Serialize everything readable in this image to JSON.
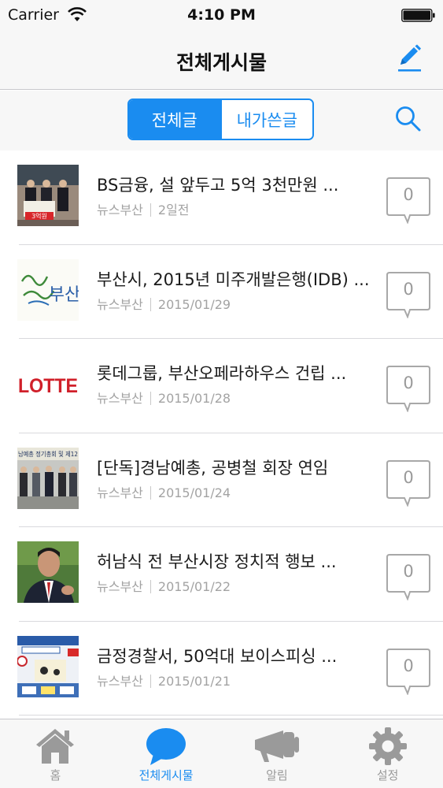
{
  "status_bar": {
    "carrier": "Carrier",
    "time": "4:10 PM"
  },
  "nav": {
    "title": "전체게시물",
    "compose_icon": "pencil-icon"
  },
  "segments": {
    "all": "전체글",
    "mine": "내가쓴글"
  },
  "search_icon": "search-icon",
  "posts": [
    {
      "title": "BS금융, 설 앞두고 5억 3천만원 ...",
      "source": "뉴스부산",
      "date": "2일전",
      "comments": "0",
      "thumb_text": "3억원"
    },
    {
      "title": "부산시, 2015년 미주개발은행(IDB) ...",
      "source": "뉴스부산",
      "date": "2015/01/29",
      "comments": "0",
      "thumb_text": "부산"
    },
    {
      "title": "롯데그룹, 부산오페라하우스 건립 ...",
      "source": "뉴스부산",
      "date": "2015/01/28",
      "comments": "0",
      "thumb_text": "LOTTE"
    },
    {
      "title": "[단독]경남예총, 공병철 회장 연임",
      "source": "뉴스부산",
      "date": "2015/01/24",
      "comments": "0",
      "thumb_text": "남예총 정기총회 및 제12"
    },
    {
      "title": "허남식 전 부산시장 정치적 행보 ...",
      "source": "뉴스부산",
      "date": "2015/01/22",
      "comments": "0",
      "thumb_text": ""
    },
    {
      "title": "금정경찰서, 50억대 보이스피싱 ...",
      "source": "뉴스부산",
      "date": "2015/01/21",
      "comments": "0",
      "thumb_text": ""
    }
  ],
  "tabs": [
    {
      "label": "홈",
      "icon": "home-icon"
    },
    {
      "label": "전체게시물",
      "icon": "speech-bubble-icon"
    },
    {
      "label": "알림",
      "icon": "megaphone-icon"
    },
    {
      "label": "설정",
      "icon": "gear-icon"
    }
  ],
  "colors": {
    "accent": "#1a8cf0",
    "meta_text": "#a3a3a3",
    "lotte_red": "#d0202a"
  }
}
